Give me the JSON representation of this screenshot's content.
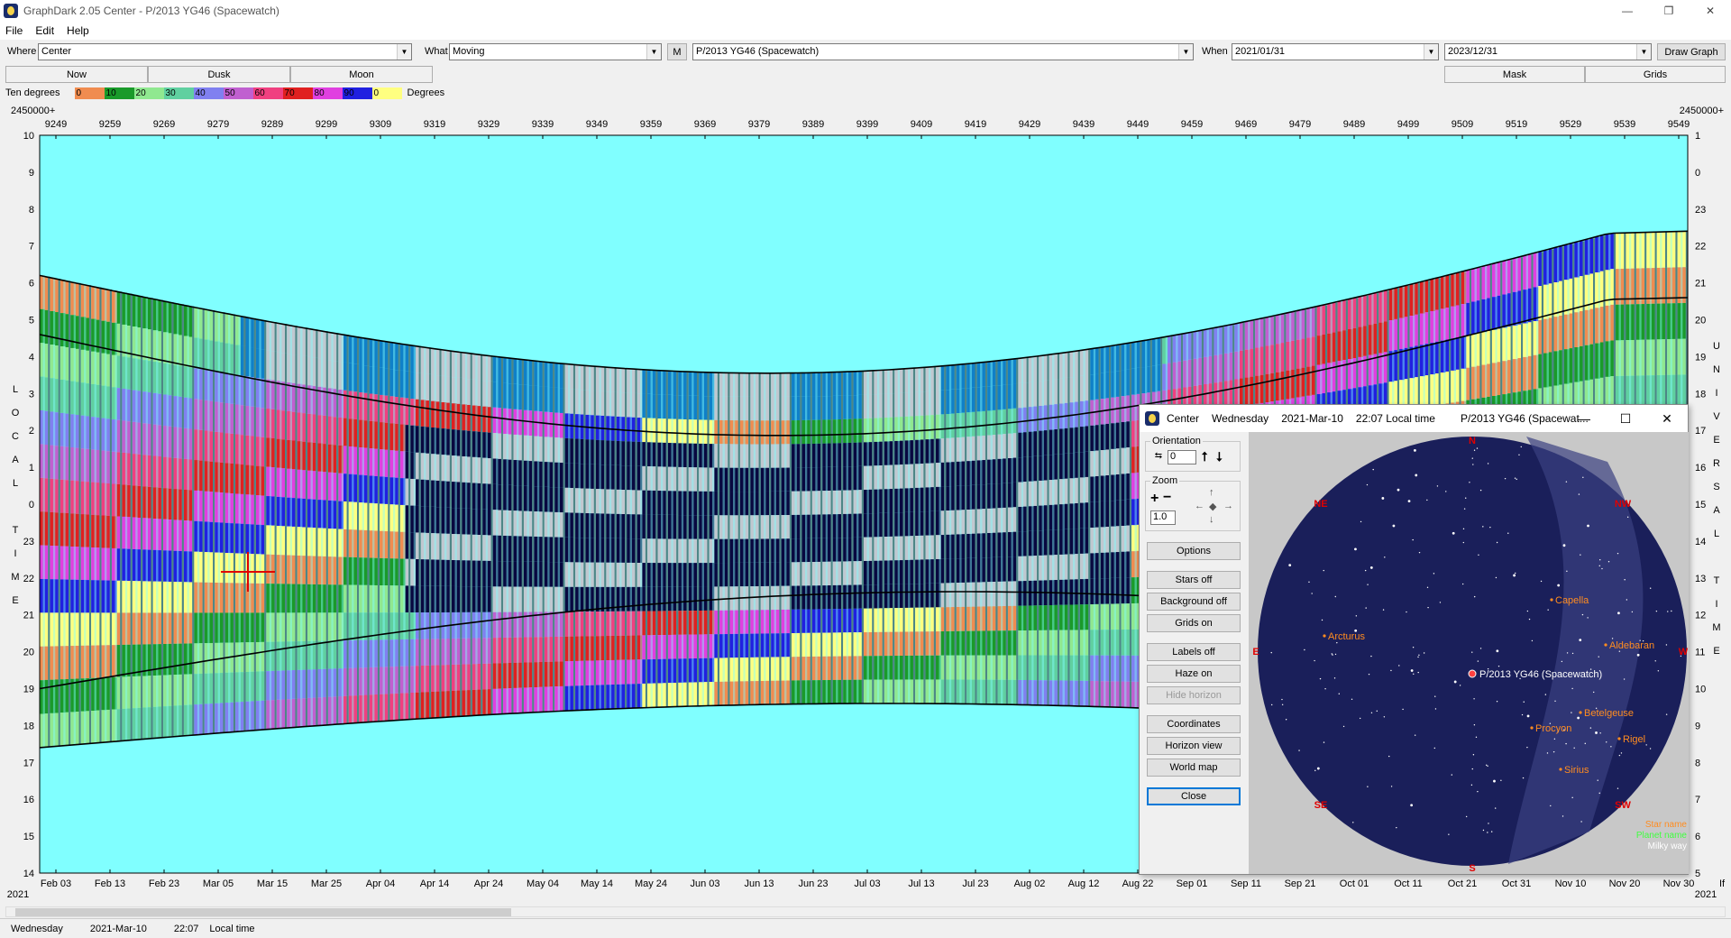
{
  "window": {
    "title": "GraphDark 2.05  Center  -  P/2013 YG46 (Spacewatch)",
    "minimize": "—",
    "maximize": "❐",
    "close": "✕"
  },
  "menu": [
    "File",
    "Edit",
    "Help"
  ],
  "toolbar": {
    "where_label": "Where",
    "where_value": "Center",
    "what_label": "What",
    "what_value": "Moving",
    "m_label": "M",
    "object_value": "P/2013 YG46 (Spacewatch)",
    "when_label": "When",
    "when_from": "2021/01/31",
    "when_to": "2023/12/31",
    "draw_graph": "Draw Graph"
  },
  "tabs": {
    "now": "Now",
    "dusk": "Dusk",
    "moon": "Moon",
    "mask": "Mask",
    "grids": "Grids"
  },
  "legend": {
    "label": "Ten degrees",
    "units": "Degrees",
    "steps": [
      {
        "label": "0",
        "color": "#f08c50"
      },
      {
        "label": "10",
        "color": "#1a9a2a"
      },
      {
        "label": "20",
        "color": "#90e890"
      },
      {
        "label": "30",
        "color": "#60d0a0"
      },
      {
        "label": "40",
        "color": "#8080f0"
      },
      {
        "label": "50",
        "color": "#c060d0"
      },
      {
        "label": "60",
        "color": "#f04080"
      },
      {
        "label": "70",
        "color": "#e02020"
      },
      {
        "label": "80",
        "color": "#e040e0"
      },
      {
        "label": "90",
        "color": "#2020e0"
      },
      {
        "label": "0",
        "color": "#ffff80"
      }
    ]
  },
  "chart": {
    "jd_prefix_left": "2450000+",
    "jd_prefix_right": "2450000+",
    "jd_ticks": [
      "9249",
      "9259",
      "9269",
      "9279",
      "9289",
      "9299",
      "9309",
      "9319",
      "9329",
      "9339",
      "9349",
      "9359",
      "9369",
      "9379",
      "9389",
      "9399",
      "9409",
      "9419",
      "9429",
      "9439",
      "9449",
      "9459",
      "9469",
      "9479",
      "9489",
      "9499",
      "9509",
      "9519",
      "9529",
      "9539",
      "9549"
    ],
    "date_ticks": [
      "Feb 03",
      "Feb 13",
      "Feb 23",
      "Mar 05",
      "Mar 15",
      "Mar 25",
      "Apr 04",
      "Apr 14",
      "Apr 24",
      "May 04",
      "May 14",
      "May 24",
      "Jun 03",
      "Jun 13",
      "Jun 23",
      "Jul 03",
      "Jul 13",
      "Jul 23",
      "Aug 02",
      "Aug 12",
      "Aug 22",
      "Sep 01",
      "Sep 11",
      "Sep 21",
      "Oct 01",
      "Oct 11",
      "Oct 21",
      "Oct 31",
      "Nov 10",
      "Nov 20",
      "Nov 30"
    ],
    "year_left": "2021",
    "year_right": "2021",
    "left_hours": [
      "10",
      "9",
      "8",
      "7",
      "6",
      "5",
      "4",
      "3",
      "2",
      "1",
      "0",
      "23",
      "22",
      "21",
      "20",
      "19",
      "18",
      "17",
      "16",
      "15",
      "14"
    ],
    "right_hours": [
      "1",
      "0",
      "23",
      "22",
      "21",
      "20",
      "19",
      "18",
      "17",
      "16",
      "15",
      "14",
      "13",
      "12",
      "11",
      "10",
      "9",
      "8",
      "7",
      "6",
      "5"
    ],
    "left_vertical_label": [
      "L",
      "O",
      "C",
      "A",
      "L",
      "",
      "T",
      "I",
      "M",
      "E"
    ],
    "right_vertical_label": [
      "U",
      "N",
      "I",
      "V",
      "E",
      "R",
      "S",
      "A",
      "L",
      "",
      "T",
      "I",
      "M",
      "E"
    ],
    "right_extra": "If",
    "colors": {
      "day": "#80ffff",
      "twilight_blue": "#0f80c8",
      "night": "#080840",
      "stripe_gray": "#c0c8d0"
    }
  },
  "dialog": {
    "title_app": "Center",
    "title_day": "Wednesday",
    "title_date": "2021-Mar-10",
    "title_time": "22:07 Local time",
    "title_object": "P/2013 YG46 (Spacewat...",
    "orientation_label": "Orientation",
    "orientation_value": "0",
    "zoom_label": "Zoom",
    "zoom_value": "1.0",
    "buttons": {
      "options": "Options",
      "stars_off": "Stars off",
      "background_off": "Background off",
      "grids_on": "Grids on",
      "labels_off": "Labels off",
      "haze_on": "Haze on",
      "hide_horizon": "Hide horizon",
      "coordinates": "Coordinates",
      "horizon_view": "Horizon view",
      "world_map": "World map",
      "close": "Close"
    },
    "sky": {
      "compass": {
        "n": "N",
        "ne": "NE",
        "nw": "NW",
        "e": "E",
        "w": "W",
        "se": "SE",
        "sw": "SW",
        "s": "S"
      },
      "stars": [
        "Capella",
        "Arcturus",
        "Aldebaran",
        "Betelgeuse",
        "Procyon",
        "Rigel",
        "Sirius"
      ],
      "target": "P/2013 YG46 (Spacewatch)",
      "legend": [
        "Star name",
        "Planet name",
        "Milky way"
      ],
      "legend_colors": [
        "#ff8c20",
        "#40ff40",
        "#ffffff"
      ]
    }
  },
  "status": {
    "day": "Wednesday",
    "date": "2021-Mar-10",
    "time": "22:07",
    "time_label": "Local time"
  }
}
